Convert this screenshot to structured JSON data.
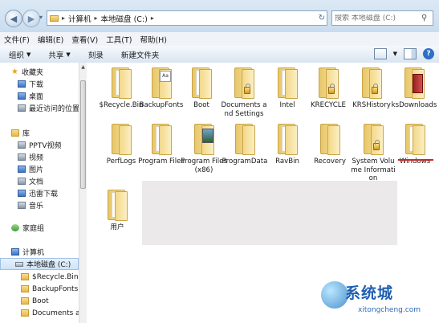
{
  "address": {
    "segments": [
      "计算机",
      "本地磁盘 (C:)"
    ],
    "search_placeholder": "搜索 本地磁盘 (C:)"
  },
  "menu": [
    "文件(F)",
    "编辑(E)",
    "查看(V)",
    "工具(T)",
    "帮助(H)"
  ],
  "toolbar": {
    "organize": "组织",
    "share": "共享",
    "burn": "刻录",
    "new_folder": "新建文件夹"
  },
  "nav": {
    "favorites": "收藏夹",
    "downloads": "下载",
    "desktop": "桌面",
    "recent": "最近访问的位置",
    "libraries": "库",
    "pptv": "PPTV视频",
    "videos": "视频",
    "pictures": "图片",
    "documents": "文档",
    "thunder": "迅雷下载",
    "music": "音乐",
    "homegroup": "家庭组",
    "computer": "计算机",
    "local_disk": "本地磁盘 (C:)",
    "recycle": "$Recycle.Bin",
    "backupfonts": "BackupFonts",
    "boot": "Boot",
    "docs_settings": "Documents an"
  },
  "folders": {
    "f1": "$Recycle.Bin",
    "f2": "BackupFonts",
    "f3": "Boot",
    "f4": "Documents and Settings",
    "f5": "Intel",
    "f6": "KRECYCLE",
    "f7": "KRSHistory",
    "f8": "ksDownloads",
    "f9": "PerfLogs",
    "f10": "Program Files",
    "f11": "Program Files (x86)",
    "f12": "ProgramData",
    "f13": "RavBin",
    "f14": "Recovery",
    "f15": "System Volume Information",
    "f16": "Windows",
    "f17": "用户"
  },
  "watermark": {
    "brand": "系统城",
    "url": "xitongcheng.com"
  },
  "colors": {
    "highlight_underline": "#c82a2a",
    "toolbar_bg": "#dae5f1",
    "selection": "#cfe3f8"
  }
}
